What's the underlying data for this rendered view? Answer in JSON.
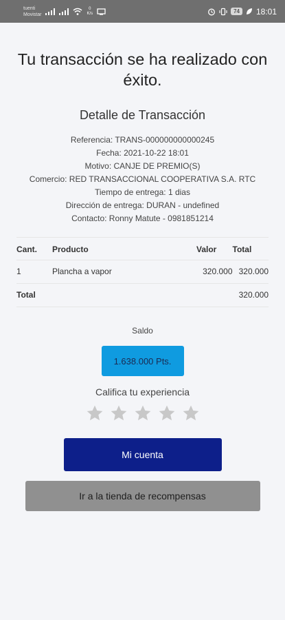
{
  "status_bar": {
    "carrier_line1": "tuenti",
    "carrier_line2": "Movistar",
    "speed_value": "0",
    "speed_unit": "K/s",
    "battery": "74",
    "time": "18:01"
  },
  "success_title": "Tu transacción se ha realizado con éxito.",
  "detail": {
    "title": "Detalle de Transacción",
    "lines": [
      "Referencia: TRANS-000000000000245",
      "Fecha: 2021-10-22 18:01",
      "Motivo: CANJE DE PREMIO(S)",
      "Comercio: RED TRANSACCIONAL COOPERATIVA S.A. RTC",
      "Tiempo de entrega: 1 dias",
      "Dirección de entrega: DURAN - undefined",
      "Contacto: Ronny Matute - 0981851214"
    ]
  },
  "table": {
    "headers": [
      "Cant.",
      "Producto",
      "Valor",
      "Total"
    ],
    "rows": [
      [
        "1",
        "Plancha a vapor",
        "320.000",
        "320.000"
      ]
    ],
    "total_label": "Total",
    "total_value": "320.000"
  },
  "balance": {
    "label": "Saldo",
    "points": "1.638.000 Pts."
  },
  "rating": {
    "label": "Califica tu experiencia",
    "value": 0,
    "max": 5,
    "star_color": "#c8c8c8"
  },
  "buttons": {
    "account": "Mi cuenta",
    "store": "Ir a la tienda de recompensas"
  },
  "colors": {
    "primary_button": "#0d1f8a",
    "secondary_button": "#909090",
    "points_badge": "#0f9be0",
    "status_bar": "#6f6f6f"
  }
}
